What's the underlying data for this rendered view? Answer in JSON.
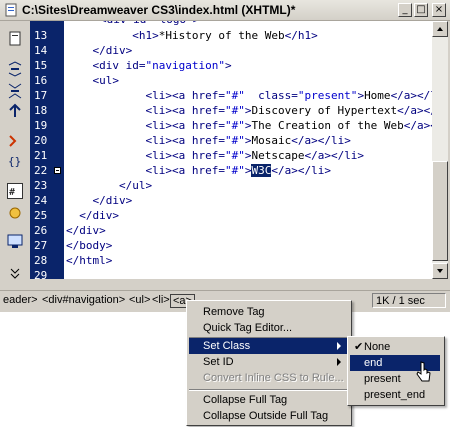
{
  "window": {
    "title": "C:\\Sites\\Dreamweaver CS3\\index.html (XHTML)*",
    "minimize": "_",
    "maximize": "□",
    "close": "×"
  },
  "toolbar": {
    "icons": [
      "file-management-icon",
      "expand-icon",
      "collapse-icon",
      "select-parent-icon",
      "balance-braces-icon",
      "line-numbers-icon",
      "highlight-invalid-icon",
      "word-wrap-icon",
      "more-icon"
    ]
  },
  "code": {
    "lines": [
      {
        "num": "13",
        "fold": false,
        "parts": [
          [
            "txt",
            "  "
          ],
          [
            "tag",
            "<h1>"
          ],
          [
            "txt",
            "*History of the Web"
          ],
          [
            "tag",
            "</h1>"
          ]
        ],
        "indent": "    "
      },
      {
        "num": "14",
        "fold": false,
        "parts": [
          [
            "tag",
            "</div>"
          ]
        ],
        "indent": "  "
      },
      {
        "num": "15",
        "fold": false,
        "parts": [
          [
            "tag",
            "<div "
          ],
          [
            "attr",
            "id="
          ],
          [
            "val",
            "\"navigation\""
          ],
          [
            "tag",
            ">"
          ]
        ],
        "indent": "  "
      },
      {
        "num": "16",
        "fold": false,
        "parts": [
          [
            "tag",
            "<ul>"
          ]
        ],
        "indent": "  "
      },
      {
        "num": "17",
        "fold": false,
        "parts": [
          [
            "tag",
            "<li><a "
          ],
          [
            "attr",
            "href="
          ],
          [
            "val",
            "\"#\""
          ],
          [
            "attr",
            "  class="
          ],
          [
            "val",
            "\"present\""
          ],
          [
            "tag",
            ">"
          ],
          [
            "txt",
            "Home"
          ],
          [
            "tag",
            "</a></li>"
          ]
        ],
        "indent": "      "
      },
      {
        "num": "18",
        "fold": false,
        "parts": [
          [
            "tag",
            "<li><a "
          ],
          [
            "attr",
            "href="
          ],
          [
            "val",
            "\"#\""
          ],
          [
            "tag",
            ">"
          ],
          [
            "txt",
            "Discovery of Hypertext"
          ],
          [
            "tag",
            "</a></li>"
          ]
        ],
        "indent": "      "
      },
      {
        "num": "19",
        "fold": false,
        "parts": [
          [
            "tag",
            "<li><a "
          ],
          [
            "attr",
            "href="
          ],
          [
            "val",
            "\"#\""
          ],
          [
            "tag",
            ">"
          ],
          [
            "txt",
            "The Creation of the Web"
          ],
          [
            "tag",
            "</a></li>"
          ]
        ],
        "indent": "      "
      },
      {
        "num": "20",
        "fold": false,
        "parts": [
          [
            "tag",
            "<li><a "
          ],
          [
            "attr",
            "href="
          ],
          [
            "val",
            "\"#\""
          ],
          [
            "tag",
            ">"
          ],
          [
            "txt",
            "Mosaic"
          ],
          [
            "tag",
            "</a></li>"
          ]
        ],
        "indent": "      "
      },
      {
        "num": "21",
        "fold": false,
        "parts": [
          [
            "tag",
            "<li><a "
          ],
          [
            "attr",
            "href="
          ],
          [
            "val",
            "\"#\""
          ],
          [
            "tag",
            ">"
          ],
          [
            "txt",
            "Netscape"
          ],
          [
            "tag",
            "</a></li>"
          ]
        ],
        "indent": "      "
      },
      {
        "num": "22",
        "fold": true,
        "parts": [
          [
            "tag",
            "<li><a "
          ],
          [
            "attr",
            "href="
          ],
          [
            "val",
            "\"#\""
          ],
          [
            "tag",
            ">"
          ],
          [
            "sel",
            "W3C"
          ],
          [
            "tag",
            "</a></li>"
          ]
        ],
        "indent": "      "
      },
      {
        "num": "23",
        "fold": false,
        "parts": [
          [
            "tag",
            "</ul>"
          ]
        ],
        "indent": "    "
      },
      {
        "num": "24",
        "fold": false,
        "parts": [
          [
            "tag",
            "</div>"
          ]
        ],
        "indent": "  "
      },
      {
        "num": "25",
        "fold": false,
        "parts": [
          [
            "tag",
            "</div>"
          ]
        ],
        "indent": " "
      },
      {
        "num": "26",
        "fold": false,
        "parts": [
          [
            "tag",
            "</div>"
          ]
        ],
        "indent": ""
      },
      {
        "num": "27",
        "fold": false,
        "parts": [
          [
            "tag",
            "</body>"
          ]
        ],
        "indent": ""
      },
      {
        "num": "28",
        "fold": false,
        "parts": [
          [
            "tag",
            "</html>"
          ]
        ],
        "indent": ""
      },
      {
        "num": "29",
        "fold": false,
        "parts": [],
        "indent": ""
      }
    ],
    "partial_top": "<div id=\"logo\">"
  },
  "statusbar": {
    "crumbs": [
      "eader>",
      "<div#navigation>",
      "<ul>",
      "<li>",
      "<a>"
    ],
    "size": "1K / 1 sec"
  },
  "context_menu": {
    "items": [
      {
        "label": "Remove Tag",
        "submenu": false,
        "disabled": false,
        "highlight": false
      },
      {
        "label": "Quick Tag Editor...",
        "submenu": false,
        "disabled": false,
        "highlight": false
      },
      {
        "label": "Set Class",
        "submenu": true,
        "disabled": false,
        "highlight": true
      },
      {
        "label": "Set ID",
        "submenu": true,
        "disabled": false,
        "highlight": false
      },
      {
        "label": "Convert Inline CSS to Rule...",
        "submenu": false,
        "disabled": true,
        "highlight": false
      },
      {
        "label": "Collapse Full Tag",
        "submenu": false,
        "disabled": false,
        "highlight": false
      },
      {
        "label": "Collapse Outside Full Tag",
        "submenu": false,
        "disabled": false,
        "highlight": false
      }
    ]
  },
  "class_submenu": {
    "items": [
      {
        "label": "None",
        "checked": true,
        "highlight": false
      },
      {
        "label": "end",
        "checked": false,
        "highlight": true
      },
      {
        "label": "present",
        "checked": false,
        "highlight": false
      },
      {
        "label": "present_end",
        "checked": false,
        "highlight": false
      }
    ]
  },
  "colors": {
    "selection": "#0a246a",
    "tag": "#000080",
    "value": "#0000cc"
  }
}
